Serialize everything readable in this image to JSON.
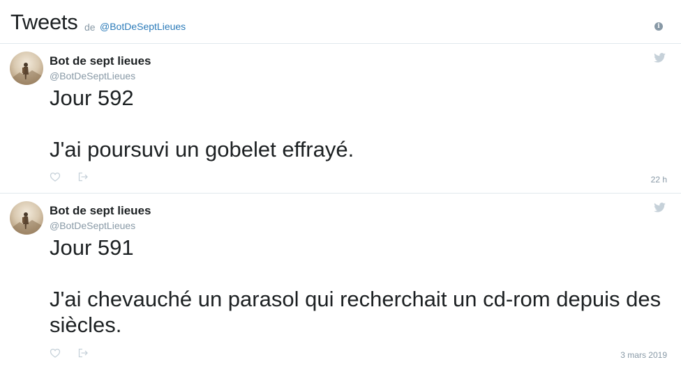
{
  "header": {
    "title": "Tweets",
    "by": "de",
    "handle": "@BotDeSeptLieues"
  },
  "tweets": [
    {
      "author_name": "Bot de sept lieues",
      "author_handle": "@BotDeSeptLieues",
      "text": "Jour 592\n\nJ'ai poursuvi un gobelet effrayé.",
      "timestamp": "22 h"
    },
    {
      "author_name": "Bot de sept lieues",
      "author_handle": "@BotDeSeptLieues",
      "text": "Jour 591\n\nJ'ai chevauché un parasol qui recherchait un cd-rom depuis des siècles.",
      "timestamp": "3 mars 2019"
    }
  ],
  "icons": {
    "info": "info-icon",
    "bird": "twitter-bird-icon",
    "like": "heart-icon",
    "share": "share-icon"
  },
  "colors": {
    "link": "#2b7bb9",
    "muted": "#8899a6",
    "divider": "#e1e8ed",
    "icon_light": "#c6d1d9"
  }
}
